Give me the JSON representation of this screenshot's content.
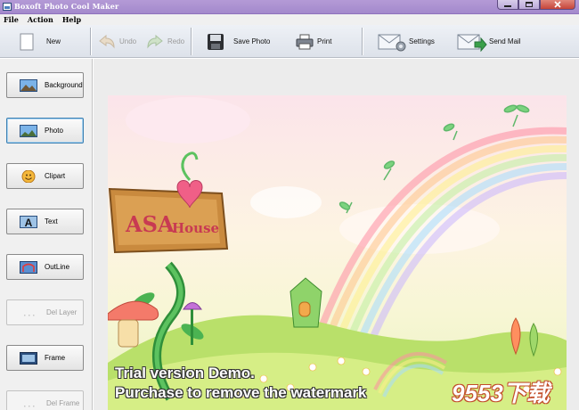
{
  "window": {
    "title": "Boxoft Photo Cool Maker"
  },
  "menu": [
    "File",
    "Action",
    "Help"
  ],
  "toolbar": {
    "new": "New",
    "undo": "Undo",
    "redo": "Redo",
    "save_photo": "Save Photo",
    "print": "Print",
    "settings": "Settings",
    "send_mail": "Send Mail"
  },
  "sidebar": {
    "items": [
      {
        "label": "Background",
        "icon": "landscape-photo-icon",
        "state": "normal"
      },
      {
        "label": "Photo",
        "icon": "photo-icon",
        "state": "selected"
      },
      {
        "label": "Clipart",
        "icon": "smiley-icon",
        "state": "normal"
      },
      {
        "label": "Text",
        "icon": "text-letter-icon",
        "state": "normal"
      },
      {
        "label": "OutLine",
        "icon": "outline-icon",
        "state": "normal"
      },
      {
        "label": "Del Layer",
        "icon": "delete-layer-icon",
        "state": "disabled"
      },
      {
        "label": "Frame",
        "icon": "frame-icon",
        "state": "normal"
      },
      {
        "label": "Del Frame",
        "icon": "delete-frame-icon",
        "state": "disabled"
      }
    ]
  },
  "canvas": {
    "sign_text_1": "ASA",
    "sign_text_2": "House",
    "watermark_line1": "Trial version Demo.",
    "watermark_line2": "Purchase to remove the watermark",
    "corner_logo": "9553下载"
  },
  "colors": {
    "titlebar": "#a389cc",
    "toolbar": "#e3e7ee",
    "panel": "#f0f0f0",
    "selected_border": "#3c7fb1"
  }
}
